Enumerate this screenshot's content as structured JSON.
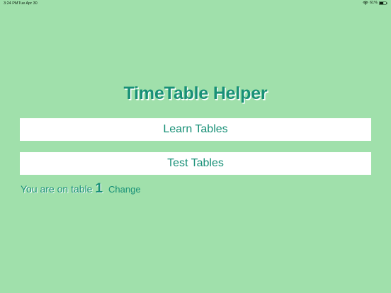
{
  "status_bar": {
    "time": "3:24 PM",
    "date": "Tue Apr 30",
    "battery_percent": "61%",
    "wifi_icon": "wifi-icon",
    "battery_icon": "battery-icon",
    "battery_level": 0.61
  },
  "app": {
    "title": "TimeTable Helper",
    "learn_label": "Learn Tables",
    "test_label": "Test Tables",
    "table_label": "You are on table",
    "current_table": "1",
    "change_label": "Change"
  },
  "colors": {
    "background": "#a0e0ab",
    "accent": "#189077",
    "button_background": "#ffffff"
  }
}
